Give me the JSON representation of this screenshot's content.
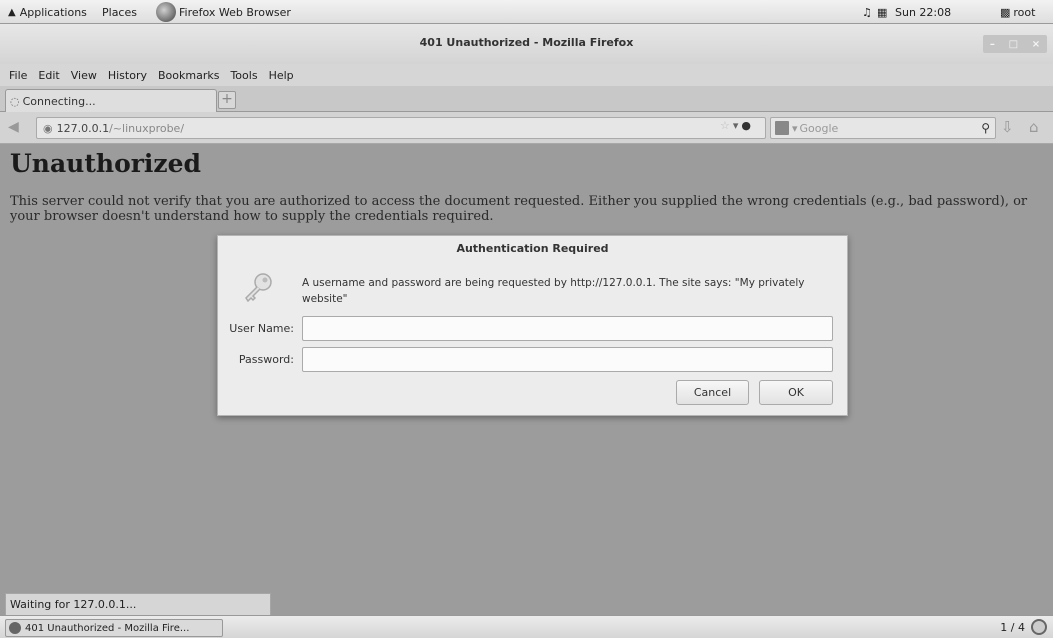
{
  "top_panel": {
    "applications": "Applications",
    "places": "Places",
    "active_app": "Firefox Web Browser",
    "volume_icon": "volume-icon",
    "clock": "Sun 22:08",
    "user": "root"
  },
  "window": {
    "title": "401 Unauthorized - Mozilla Firefox"
  },
  "menu": [
    "File",
    "Edit",
    "View",
    "History",
    "Bookmarks",
    "Tools",
    "Help"
  ],
  "tab": {
    "label": "Connecting...",
    "new_tab": "+"
  },
  "nav": {
    "url_host": "127.0.0.1",
    "url_path": "/~linuxprobe/",
    "search_placeholder": "Google"
  },
  "page": {
    "heading": "Unauthorized",
    "body": "This server could not verify that you are authorized to access the document requested. Either you supplied the wrong credentials (e.g., bad password), or your browser doesn't understand how to supply the credentials required."
  },
  "dialog": {
    "title": "Authentication Required",
    "message": "A username and password are being requested by http://127.0.0.1. The site says: \"My privately website\"",
    "username_label": "User Name:",
    "username_value": "",
    "password_label": "Password:",
    "password_value": "",
    "cancel": "Cancel",
    "ok": "OK"
  },
  "status": "Waiting for 127.0.0.1...",
  "taskbar": {
    "window_button": "401 Unauthorized - Mozilla Fire...",
    "workspace": "1 / 4"
  }
}
